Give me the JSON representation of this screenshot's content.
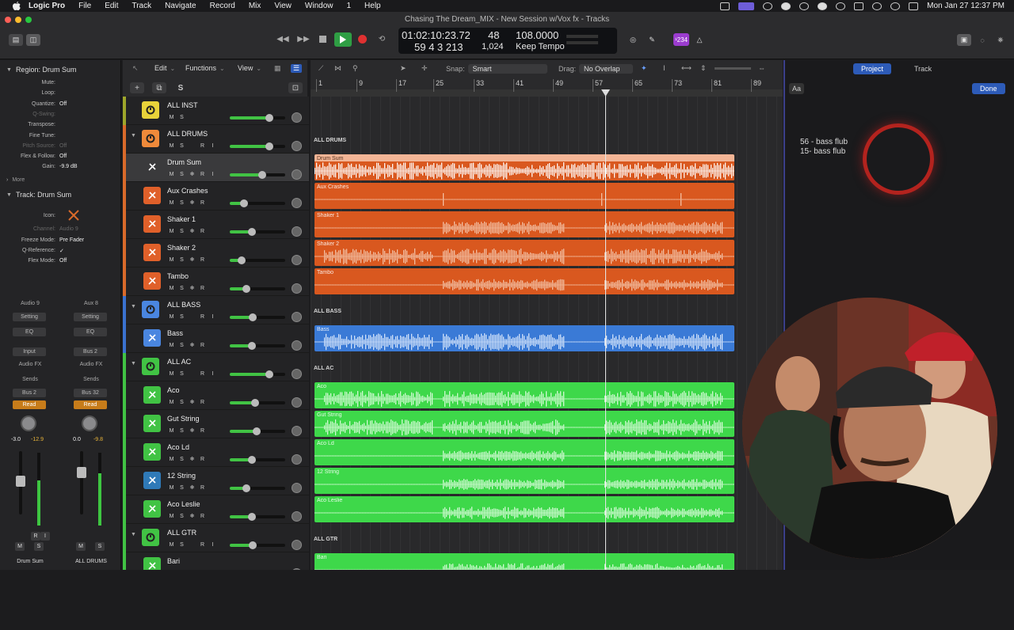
{
  "menubar": {
    "apple_icon": "apple-icon",
    "items": [
      "Logic Pro",
      "File",
      "Edit",
      "Track",
      "Navigate",
      "Record",
      "Mix",
      "View",
      "Window",
      "1",
      "Help"
    ],
    "status_icons": [
      "display-icon",
      "screen-share-icon",
      "play-icon",
      "record-icon",
      "sync-icon",
      "moon-icon",
      "power-icon",
      "bluetooth-icon",
      "wifi-icon",
      "search-icon",
      "control-center-icon"
    ],
    "datetime": "Mon Jan 27  12:37 PM"
  },
  "window": {
    "title": "Chasing The Dream_MIX - New Session w/Vox fx - Tracks"
  },
  "lcd": {
    "time": "01:02:10:23.72",
    "position": "59  4  3  213",
    "bar": "48",
    "division": "1,024",
    "tempo": "108.0000",
    "tempo_mode": "Keep Tempo",
    "count_badge": "¹234"
  },
  "inspector": {
    "region_header": "Region: Drum Sum",
    "region_params": [
      {
        "label": "Mute:",
        "value": ""
      },
      {
        "label": "Loop:",
        "value": ""
      },
      {
        "label": "Quantize:",
        "value": "Off"
      },
      {
        "label": "Q-Swing:",
        "value": ""
      },
      {
        "label": "Transpose:",
        "value": ""
      },
      {
        "label": "Fine Tune:",
        "value": ""
      },
      {
        "label": "Pitch Source:",
        "value": "Off"
      },
      {
        "label": "Flex & Follow:",
        "value": "Off"
      },
      {
        "label": "Gain:",
        "value": "-9.9 dB"
      }
    ],
    "more": "More",
    "track_header": "Track: Drum Sum",
    "track_params": [
      {
        "label": "Icon:",
        "value": ""
      },
      {
        "label": "Channel:",
        "value": "Audio 9"
      },
      {
        "label": "Freeze Mode:",
        "value": "Pre Fader"
      },
      {
        "label": "Q-Reference:",
        "value": "✓"
      },
      {
        "label": "Flex Mode:",
        "value": "Off"
      }
    ],
    "strips": [
      {
        "top": "Audio 9",
        "setting": "Setting",
        "eq": "EQ",
        "input": "Input",
        "fx": "Audio FX",
        "sends": "Sends",
        "bus": "Bus 2",
        "mode": "Read",
        "val1": "-3.0",
        "val2": "-12.9",
        "m": "M",
        "s": "S",
        "r": "R",
        "i": "I",
        "name": "Drum Sum",
        "meter_level": 0.62
      },
      {
        "top": "Aux 8",
        "setting": "Setting",
        "eq": "EQ",
        "input": "Bus 2",
        "fx": "Audio FX",
        "sends": "Sends",
        "bus": "Bus 32",
        "mode": "Read",
        "val1": "0.0",
        "val2": "-9.8",
        "m": "M",
        "s": "S",
        "r": "",
        "i": "",
        "name": "ALL DRUMS",
        "meter_level": 0.72
      }
    ]
  },
  "tracks_header": {
    "edit": "Edit",
    "functions": "Functions",
    "view": "View",
    "add": "+",
    "dup": "⧉",
    "solo": "S"
  },
  "ruler_controls": {
    "snap_label": "Snap:",
    "snap_value": "Smart",
    "drag_label": "Drag:",
    "drag_value": "No Overlap"
  },
  "ruler_bars": [
    "1",
    "9",
    "17",
    "25",
    "33",
    "41",
    "49",
    "57",
    "65",
    "73",
    "81",
    "89"
  ],
  "tracks": [
    {
      "name": "ALL INST",
      "color": "#9ea62a",
      "iconc": "#e8d23a",
      "stack": true,
      "folded": false,
      "level": 0.72,
      "buttons": [
        "M",
        "S"
      ]
    },
    {
      "name": "ALL DRUMS",
      "color": "#d96a2a",
      "iconc": "#f08a3a",
      "stack": true,
      "folded": true,
      "level": 0.72,
      "buttons": [
        "M",
        "S",
        "",
        "R",
        "I"
      ]
    },
    {
      "name": "Drum Sum",
      "color": "#d96a2a",
      "iconc": "#d96a2a",
      "stack": false,
      "sel": true,
      "level": 0.58,
      "buttons": [
        "M",
        "S",
        "❄",
        "R",
        "I"
      ]
    },
    {
      "name": "Aux Crashes",
      "color": "#d96a2a",
      "iconc": "#e0602a",
      "stack": false,
      "level": 0.25,
      "buttons": [
        "M",
        "S",
        "❄",
        "R"
      ]
    },
    {
      "name": "Shaker 1",
      "color": "#d96a2a",
      "iconc": "#e0602a",
      "stack": false,
      "level": 0.4,
      "buttons": [
        "M",
        "S",
        "❄",
        "R"
      ]
    },
    {
      "name": "Shaker 2",
      "color": "#d96a2a",
      "iconc": "#e0602a",
      "stack": false,
      "level": 0.22,
      "buttons": [
        "M",
        "S",
        "❄",
        "R"
      ]
    },
    {
      "name": "Tambo",
      "color": "#d96a2a",
      "iconc": "#e0602a",
      "stack": false,
      "level": 0.3,
      "buttons": [
        "M",
        "S",
        "❄",
        "R"
      ]
    },
    {
      "name": "ALL BASS",
      "color": "#3a72d0",
      "iconc": "#4a86e0",
      "stack": true,
      "folded": true,
      "level": 0.42,
      "buttons": [
        "M",
        "S",
        "",
        "R",
        "I"
      ]
    },
    {
      "name": "Bass",
      "color": "#3a72d0",
      "iconc": "#4a86e0",
      "stack": false,
      "level": 0.4,
      "buttons": [
        "M",
        "S",
        "❄",
        "R"
      ]
    },
    {
      "name": "ALL AC",
      "color": "#41c344",
      "iconc": "#41c344",
      "stack": true,
      "folded": true,
      "level": 0.72,
      "buttons": [
        "M",
        "S",
        "",
        "R",
        "I"
      ]
    },
    {
      "name": "Aco",
      "color": "#41c344",
      "iconc": "#41c344",
      "stack": false,
      "level": 0.45,
      "buttons": [
        "M",
        "S",
        "❄",
        "R"
      ]
    },
    {
      "name": "Gut String",
      "color": "#41c344",
      "iconc": "#41c344",
      "stack": false,
      "level": 0.48,
      "buttons": [
        "M",
        "S",
        "❄",
        "R"
      ]
    },
    {
      "name": "Aco Ld",
      "color": "#41c344",
      "iconc": "#41c344",
      "stack": false,
      "level": 0.4,
      "buttons": [
        "M",
        "S",
        "❄",
        "R"
      ]
    },
    {
      "name": "12 String",
      "color": "#41c344",
      "iconc": "#2f7ab8",
      "stack": false,
      "level": 0.3,
      "buttons": [
        "M",
        "S",
        "❄",
        "R"
      ]
    },
    {
      "name": "Aco Leslie",
      "color": "#41c344",
      "iconc": "#41c344",
      "stack": false,
      "level": 0.4,
      "buttons": [
        "M",
        "S",
        "❄",
        "R"
      ]
    },
    {
      "name": "ALL GTR",
      "color": "#41c344",
      "iconc": "#41c344",
      "stack": true,
      "folded": true,
      "level": 0.42,
      "buttons": [
        "M",
        "S",
        "",
        "R",
        "I"
      ]
    },
    {
      "name": "Bari",
      "color": "#41c344",
      "iconc": "#41c344",
      "stack": false,
      "level": 0.4,
      "buttons": [
        "M",
        "S",
        "❄",
        "R"
      ]
    }
  ],
  "folders": [
    {
      "label": "ALL DRUMS",
      "row": 1
    },
    {
      "label": "ALL BASS",
      "row": 7
    },
    {
      "label": "ALL AC",
      "row": 9
    },
    {
      "label": "ALL GTR",
      "row": 15
    }
  ],
  "regions": [
    {
      "name": "Drum Sum",
      "row": 2,
      "color": "#f1b596",
      "wave": "#ffffff",
      "dense": 0.9,
      "light": true
    },
    {
      "name": "Aux Crashes",
      "row": 3,
      "color": "#d9581f",
      "wave": "#f3c3a8",
      "dense": 0.05
    },
    {
      "name": "Shaker 1",
      "row": 4,
      "color": "#d9581f",
      "wave": "#f3c3a8",
      "dense": 0.4
    },
    {
      "name": "Shaker 2",
      "row": 5,
      "color": "#d9581f",
      "wave": "#f3c3a8",
      "dense": 0.6
    },
    {
      "name": "Tambo",
      "row": 6,
      "color": "#d9581f",
      "wave": "#f3c3a8",
      "dense": 0.3
    },
    {
      "name": "Bass",
      "row": 8,
      "color": "#3a7ad6",
      "wave": "#d8e6fb",
      "dense": 0.7
    },
    {
      "name": "Aco",
      "row": 10,
      "color": "#3ed84a",
      "wave": "#d6fbd8",
      "dense": 0.6
    },
    {
      "name": "Gut String",
      "row": 11,
      "color": "#3ed84a",
      "wave": "#d6fbd8",
      "dense": 0.6
    },
    {
      "name": "Aco Ld",
      "row": 12,
      "color": "#3ed84a",
      "wave": "#d6fbd8",
      "dense": 0.25
    },
    {
      "name": "12 String",
      "row": 13,
      "color": "#3ed84a",
      "wave": "#d6fbd8",
      "dense": 0.25
    },
    {
      "name": "Aco Leslie",
      "row": 14,
      "color": "#3ed84a",
      "wave": "#d6fbd8",
      "dense": 0.35
    },
    {
      "name": "Bari",
      "row": 16,
      "color": "#3ed84a",
      "wave": "#d6fbd8",
      "dense": 0.4
    }
  ],
  "right_panel": {
    "tabs": [
      "Project",
      "Track"
    ],
    "font_button": "Aa",
    "done": "Done",
    "notes": [
      "56 - bass flub",
      "15- bass flub"
    ]
  }
}
